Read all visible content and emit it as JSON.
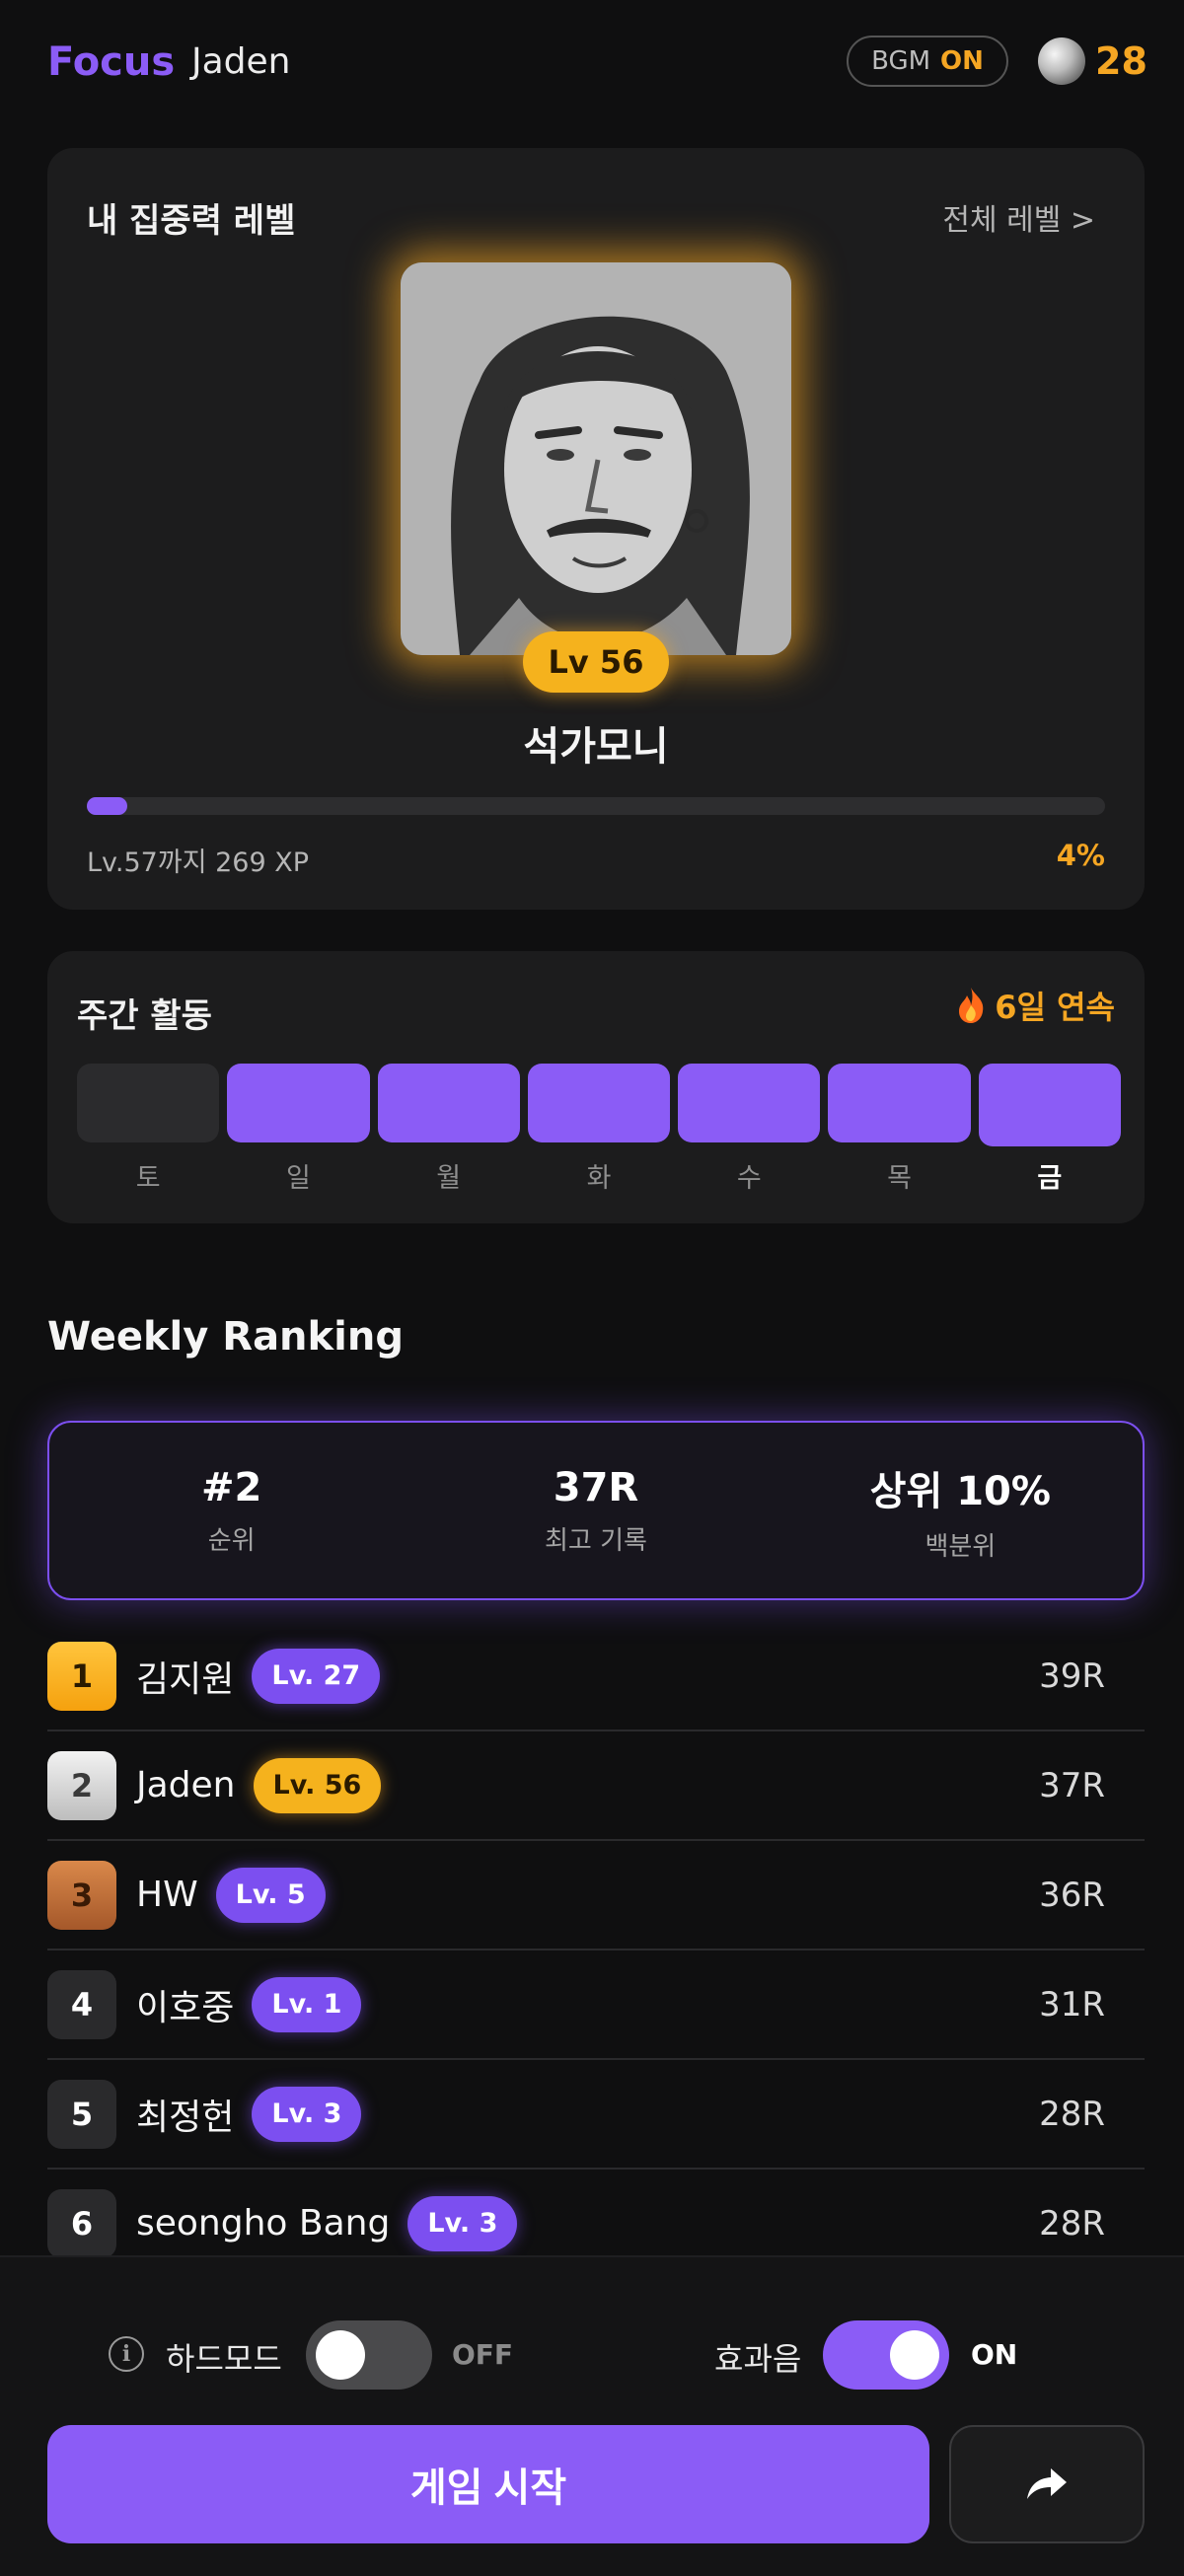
{
  "header": {
    "brand": "Focus",
    "username": "Jaden",
    "bgm_label": "BGM",
    "bgm_state": "ON",
    "coin_count": "28"
  },
  "level_card": {
    "title": "내 집중력 레벨",
    "all_levels_link": "전체 레벨 >",
    "level_badge": "Lv 56",
    "level_name": "석가모니",
    "progress_fraction": 0.04,
    "xp_text": "Lv.57까지 269 XP",
    "xp_percent": "4%"
  },
  "activity": {
    "title": "주간 활동",
    "streak_icon": "fire-icon",
    "streak_text": "6일 연속",
    "days": [
      {
        "label": "토",
        "active": false,
        "today": false
      },
      {
        "label": "일",
        "active": true,
        "today": false
      },
      {
        "label": "월",
        "active": true,
        "today": false
      },
      {
        "label": "화",
        "active": true,
        "today": false
      },
      {
        "label": "수",
        "active": true,
        "today": false
      },
      {
        "label": "목",
        "active": true,
        "today": false
      },
      {
        "label": "금",
        "active": true,
        "today": true
      }
    ]
  },
  "ranking": {
    "title": "Weekly Ranking",
    "my_stats": [
      {
        "value": "#2",
        "label": "순위"
      },
      {
        "value": "37R",
        "label": "최고 기록"
      },
      {
        "value": "상위 10%",
        "label": "백분위"
      }
    ],
    "rows": [
      {
        "rank": "1",
        "name": "김지원",
        "level": "Lv. 27",
        "score": "39R"
      },
      {
        "rank": "2",
        "name": "Jaden",
        "level": "Lv. 56",
        "score": "37R"
      },
      {
        "rank": "3",
        "name": "HW",
        "level": "Lv. 5",
        "score": "36R"
      },
      {
        "rank": "4",
        "name": "이호중",
        "level": "Lv. 1",
        "score": "31R"
      },
      {
        "rank": "5",
        "name": "최정헌",
        "level": "Lv. 3",
        "score": "28R"
      },
      {
        "rank": "6",
        "name": "seongho Bang",
        "level": "Lv. 3",
        "score": "28R"
      }
    ]
  },
  "bottom": {
    "hard_mode_label": "하드모드",
    "hard_mode_state": "OFF",
    "sfx_label": "효과음",
    "sfx_state": "ON",
    "start_button": "게임 시작",
    "share_icon": "share-icon"
  },
  "colors": {
    "accent": "#8b5cf6",
    "gold": "#f5a623",
    "background": "#0f0f10",
    "card": "#1c1c1d"
  }
}
